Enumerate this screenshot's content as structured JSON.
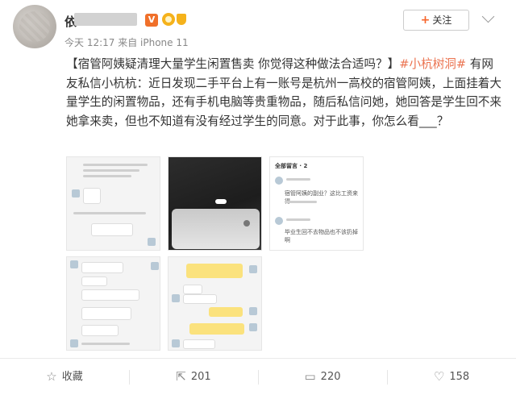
{
  "post": {
    "username": "依",
    "vip_badge": "V",
    "meta": "今天 12:17 来自 iPhone 11",
    "follow_label": "关注",
    "follow_plus": "+",
    "text_prefix": "【宿管阿姨疑清理大量学生闲置售卖 你觉得这种做法合适吗？】",
    "hashtag": "#小杭树洞#",
    "text_body": " 有网友私信小杭杭：近日发现二手平台上有一账号是杭州一高校的宿管阿姨，上面挂着大量学生的闲置物品，还有手机电脑等贵重物品，随后私信问她，她回答是学生回不来她拿来卖，但也不知道有没有经过学生的同意。对于此事，你怎么看___？"
  },
  "images": {
    "thumb3_title": "全部留言 · 2",
    "thumb3_line1": "宿管阿姨的副业？这比工资来得",
    "thumb3_line2": "毕业生回不去物品也不该扔掉啊"
  },
  "footer": {
    "collect_label": "收藏",
    "repost_count": "201",
    "comment_count": "220",
    "like_count": "158"
  },
  "icons": {
    "collect": "star-icon",
    "repost": "repost-icon",
    "comment": "comment-icon",
    "like": "thumbs-up-icon"
  },
  "colors": {
    "hashtag": "#eb7350",
    "follow_plus": "#f7652b",
    "vip": "#f0702a"
  }
}
